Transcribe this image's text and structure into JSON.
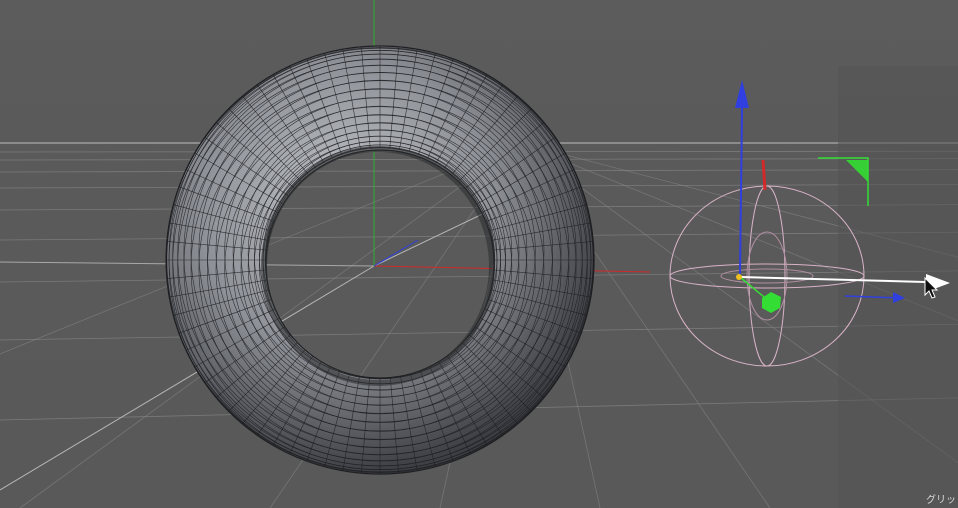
{
  "viewport": {
    "corner_label": "グリッ"
  },
  "object": {
    "kind": "torus",
    "segments_around": 72,
    "segments_tube": 36
  },
  "colors": {
    "background": "#5a5a5a",
    "grid": "#8c8c8c",
    "horizon": "#bdbdbd",
    "torus_fill": "#8a8d93",
    "wire": "#1e1f22",
    "axis_x": "#d22a2a",
    "axis_y": "#2eae2e",
    "axis_z": "#2f3fe0",
    "gizmo_ring": "#d9b3c7",
    "gizmo_handle": "#33dd33",
    "pointer": "#ffffff"
  }
}
